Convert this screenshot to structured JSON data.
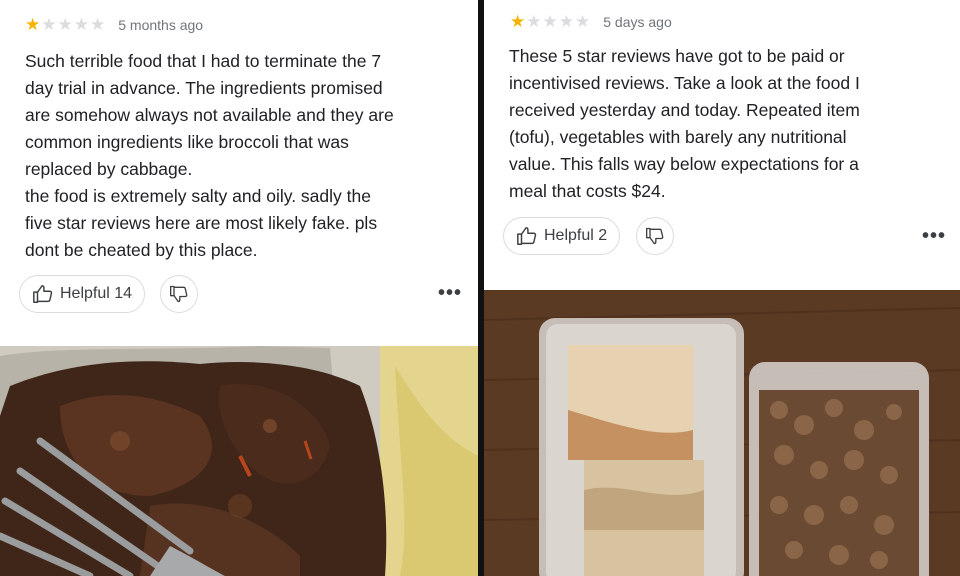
{
  "reviews": [
    {
      "rating": 1,
      "max_rating": 5,
      "date": "5 months ago",
      "text": "Such terrible food that I had to terminate the 7\nday trial in advance. The ingredients promised\nare somehow always not available and they are\ncommon ingredients like broccoli that was\nreplaced by cabbage.\nthe food is extremely salty and oily. sadly the\nfive star reviews here are most likely fake. pls\ndont be cheated by this place.",
      "helpful_label": "Helpful 14",
      "more_label": "•••"
    },
    {
      "rating": 1,
      "max_rating": 5,
      "date": "5 days ago",
      "text": "These 5 star reviews have got to be paid or\nincentivised reviews. Take a look at the food I\nreceived yesterday and today. Repeated item\n(tofu), vegetables with barely any nutritional\nvalue. This falls way below expectations for a\nmeal that costs $24.",
      "helpful_label": "Helpful 2",
      "more_label": "•••"
    }
  ],
  "icons": {
    "like": "thumbs-up-icon",
    "dislike": "thumbs-down-icon",
    "more": "more-horizontal-icon",
    "star": "star-icon"
  },
  "colors": {
    "star_filled": "#f4b400",
    "star_empty": "#dadce0",
    "date_text": "#70757a",
    "button_border": "#dadce0"
  }
}
